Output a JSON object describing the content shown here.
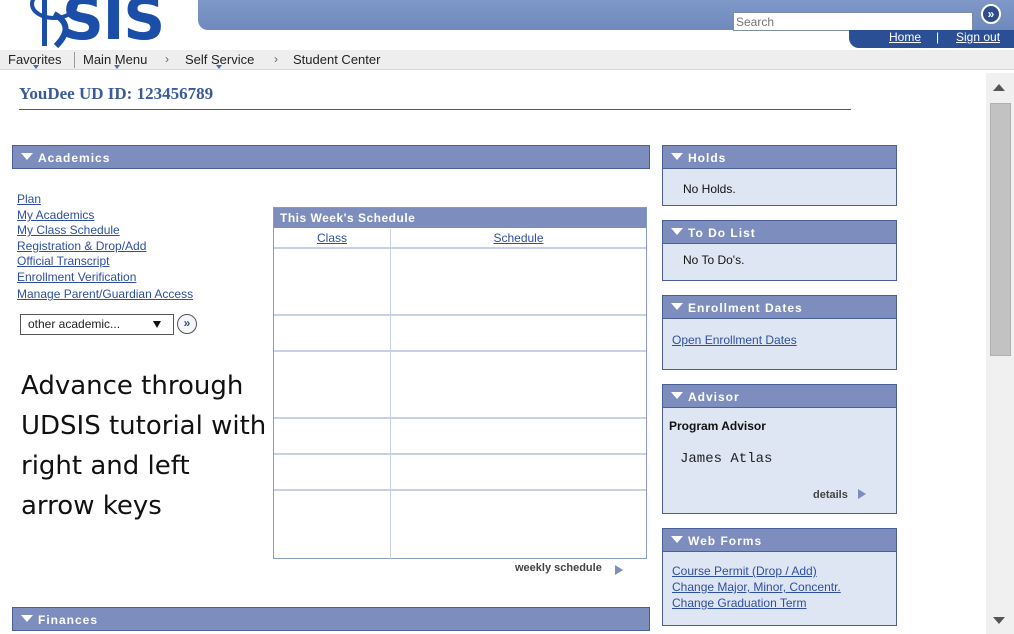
{
  "header": {
    "logo_text": "SIS",
    "search_placeholder": "Search",
    "search_go": "»",
    "home_link": "Home",
    "signout_link": "Sign out",
    "link_separator": "|"
  },
  "breadcrumb": {
    "favorites": "Favorites",
    "main_menu": "Main Menu",
    "self_service": "Self Service",
    "student_center": "Student Center",
    "arrow": "›"
  },
  "student": {
    "id_line": "YouDee UD ID: 123456789"
  },
  "academics": {
    "title": "Academics",
    "links": [
      "Plan",
      "My Academics",
      "My Class Schedule",
      "Registration & Drop/Add",
      "Official Transcript",
      "Enrollment Verification",
      "Manage Parent/Guardian Access"
    ],
    "other_select": "other academic...",
    "go": "»"
  },
  "schedule": {
    "title": "This Week's Schedule",
    "col_class": "Class",
    "col_schedule": "Schedule",
    "weekly_link": "weekly schedule"
  },
  "tutorial_text": "Advance through UDSIS tutorial with right and left arrow keys",
  "finances": {
    "title": "Finances"
  },
  "holds": {
    "title": "Holds",
    "text": "No Holds."
  },
  "todo": {
    "title": "To Do List",
    "text": "No To Do's."
  },
  "enrollment_dates": {
    "title": "Enrollment Dates",
    "link": "Open Enrollment Dates"
  },
  "advisor": {
    "title": "Advisor",
    "label": "Program Advisor",
    "name": "James Atlas",
    "details": "details"
  },
  "web_forms": {
    "title": "Web Forms",
    "links": [
      "Course Permit (Drop / Add)",
      "Change Major, Minor, Concentr.",
      "Change Graduation Term"
    ]
  },
  "colors": {
    "pagelet_header": "#7d8dbd",
    "pagelet_body": "#dfe6f3",
    "link": "#2e4fa0",
    "id_text": "#3b5a99",
    "logo_blue": "#1a4ea8"
  }
}
